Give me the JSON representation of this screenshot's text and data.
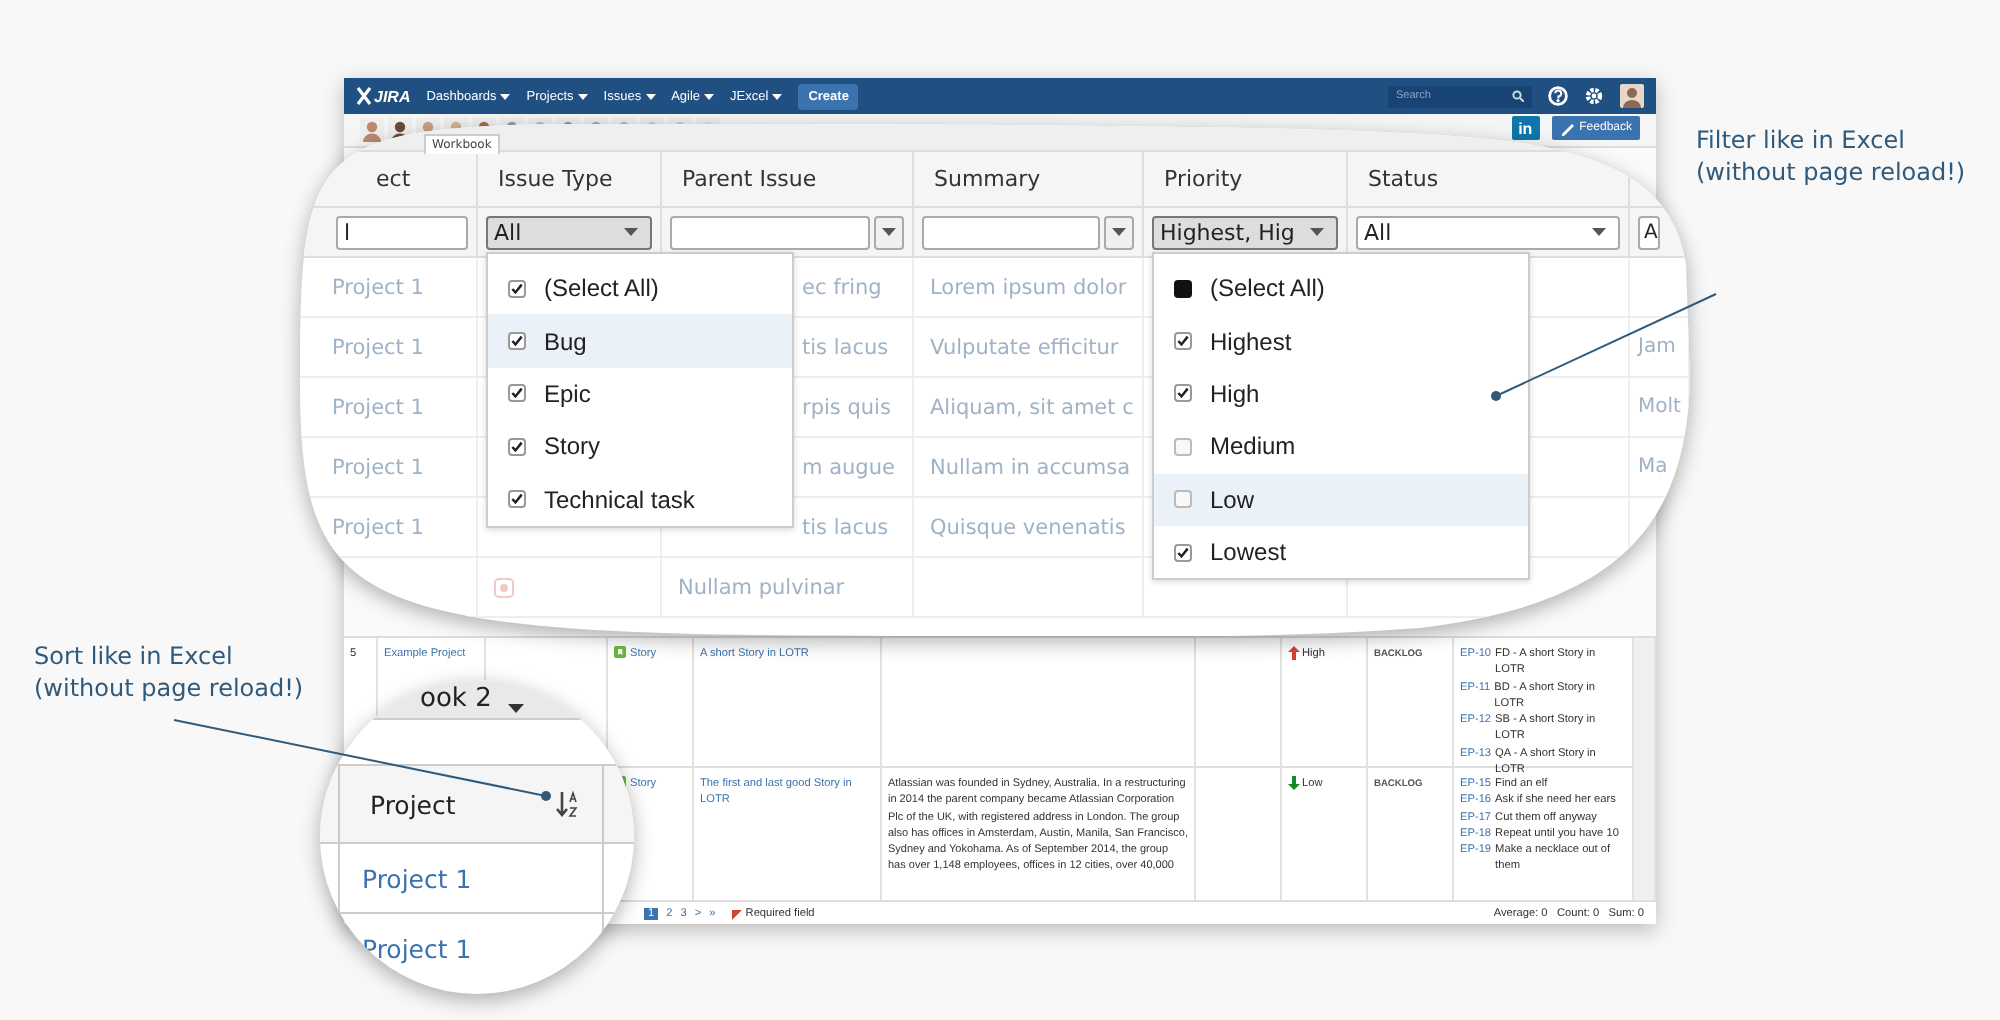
{
  "navbar": {
    "logo": "JIRA",
    "menus": [
      {
        "label": "Dashboards"
      },
      {
        "label": "Projects"
      },
      {
        "label": "Issues"
      },
      {
        "label": "Agile"
      },
      {
        "label": "JExcel"
      }
    ],
    "create": "Create",
    "search": {
      "placeholder": "Search"
    }
  },
  "toolbar": {
    "linkedin": "in",
    "feedback": "Feedback"
  },
  "filter_lens": {
    "sheet_tab": "Workbook",
    "columns": [
      {
        "header": "ect",
        "filter": "l"
      },
      {
        "header": "Issue Type",
        "filter": "All",
        "open": true
      },
      {
        "header": "Parent Issue",
        "kind": "input"
      },
      {
        "header": "Summary",
        "kind": "input"
      },
      {
        "header": "Priority",
        "filter": "Highest, Hig",
        "open": true
      },
      {
        "header": "Status",
        "filter": "All"
      },
      {
        "filter": "A"
      }
    ],
    "rows": [
      {
        "project": "Project 1",
        "parent_issue": "ec fring",
        "summary": "Lorem ipsum dolor"
      },
      {
        "project": "Project 1",
        "parent_issue": "tis lacus",
        "summary": "Vulputate efficitur",
        "column_7": "Jam"
      },
      {
        "project": "Project 1",
        "parent_issue": "rpis quis",
        "summary": "Aliquam, sit amet c",
        "column_7": "Molt"
      },
      {
        "project": "Project 1",
        "parent_issue": "m augue",
        "summary": "Nullam in accumsa",
        "column_7": "Ma"
      },
      {
        "project": "Project 1",
        "parent_issue": "tis lacus",
        "summary": "Quisque venenatis"
      },
      {
        "parent_issue": "Nullam pulvinar"
      }
    ]
  },
  "issue_type_filter": {
    "items": [
      {
        "label": "(Select All)",
        "checked": true,
        "indeterminate": false,
        "hovered": false
      },
      {
        "label": "Bug",
        "checked": true,
        "indeterminate": false,
        "hovered": true
      },
      {
        "label": "Epic",
        "checked": true,
        "indeterminate": false,
        "hovered": false
      },
      {
        "label": "Story",
        "checked": true,
        "indeterminate": false,
        "hovered": false
      },
      {
        "label": "Technical task",
        "checked": true,
        "indeterminate": false,
        "hovered": false
      }
    ]
  },
  "priority_filter": {
    "items": [
      {
        "label": "(Select All)",
        "checked": false,
        "indeterminate": true,
        "hovered": false
      },
      {
        "label": "Highest",
        "checked": true,
        "indeterminate": false,
        "hovered": false
      },
      {
        "label": "High",
        "checked": true,
        "indeterminate": false,
        "hovered": false
      },
      {
        "label": "Medium",
        "checked": false,
        "indeterminate": false,
        "hovered": false
      },
      {
        "label": "Low",
        "checked": false,
        "indeterminate": false,
        "hovered": true
      },
      {
        "label": "Lowest",
        "checked": true,
        "indeterminate": false,
        "hovered": false
      }
    ]
  },
  "table": {
    "rows": [
      {
        "number": "5",
        "project": "Example Project",
        "issue_type": "Story",
        "summary": "A short Story in LOTR",
        "priority": {
          "label": "High",
          "kind": "up"
        },
        "status": "BACKLOG",
        "linked": [
          {
            "key": "EP-10",
            "text": "FD - A short Story in LOTR"
          },
          {
            "key": "EP-11",
            "text": "BD - A short Story in LOTR"
          },
          {
            "key": "EP-12",
            "text": "SB - A short Story in LOTR"
          },
          {
            "key": "EP-13",
            "text": "QA - A short Story in LOTR"
          }
        ]
      },
      {
        "issue_type": "Story",
        "summary": "The first and last good Story in LOTR",
        "description": "Atlassian was founded in Sydney, Australia. In a restructuring in 2014 the parent company became Atlassian Corporation Plc of the UK, with registered address in London. The group also has offices in Amsterdam, Austin, Manila, San Francisco, Sydney and Yokohama. As of September 2014, the group has over 1,148 employees, offices in 12 cities, over 40,000",
        "priority": {
          "label": "Low",
          "kind": "down"
        },
        "status": "BACKLOG",
        "linked": [
          {
            "key": "EP-15",
            "text": "Find an elf"
          },
          {
            "key": "EP-16",
            "text": "Ask if she need her ears"
          },
          {
            "key": "EP-17",
            "text": "Cut them off anyway"
          },
          {
            "key": "EP-18",
            "text": "Repeat until you have 10"
          },
          {
            "key": "EP-19",
            "text": "Make a necklace out of them"
          }
        ]
      }
    ]
  },
  "footer": {
    "pages": [
      {
        "label": "1",
        "selected": true
      },
      {
        "label": "2",
        "selected": false
      },
      {
        "label": "3",
        "selected": false
      },
      {
        "label": ">",
        "selected": false
      },
      {
        "label": "»",
        "selected": false
      }
    ],
    "required": "Required field",
    "stats": "Average: 0   Count: 0   Sum: 0"
  },
  "sort_lens": {
    "sheet_tab": "ook 2",
    "header": "Project",
    "rows": [
      "Project 1",
      "Project 1"
    ]
  },
  "callouts": [
    {
      "kind": "filter",
      "lines": [
        "Filter like in Excel",
        "(without page reload!)"
      ]
    },
    {
      "kind": "sort",
      "lines": [
        "Sort like in Excel",
        "(without page reload!)"
      ]
    }
  ]
}
